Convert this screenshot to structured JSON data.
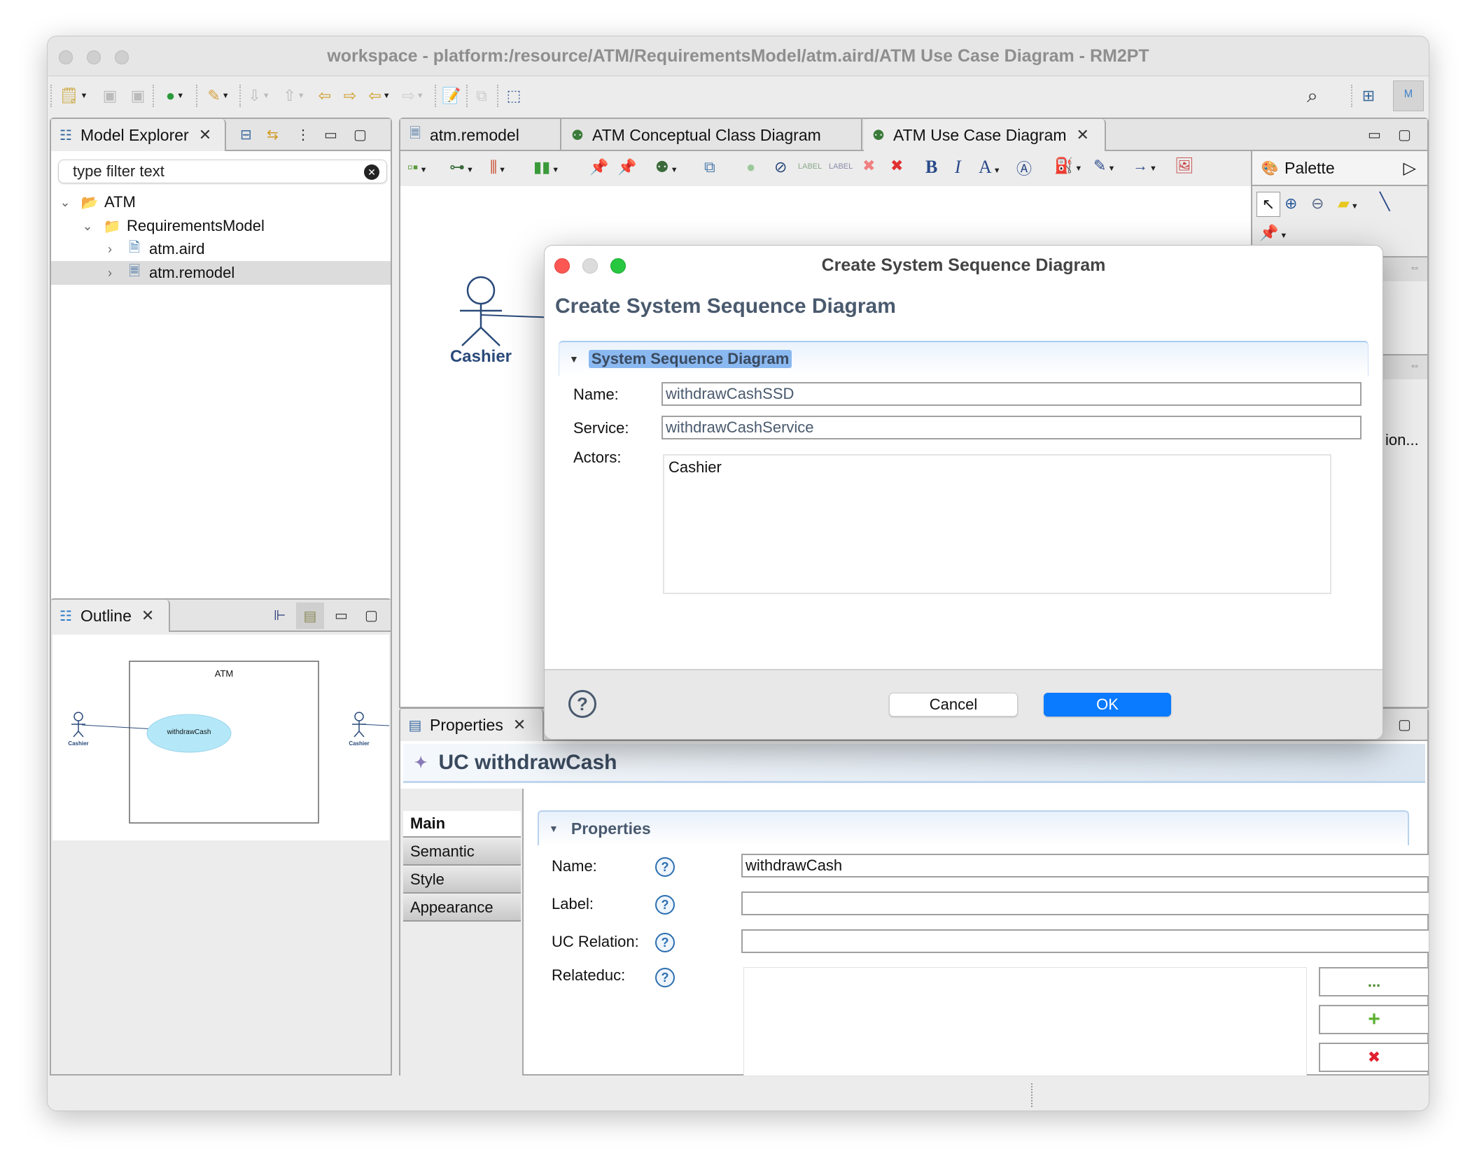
{
  "window": {
    "title": "workspace - platform:/resource/ATM/RequirementsModel/atm.aird/ATM Use Case Diagram - RM2PT"
  },
  "main_toolbar": {
    "icons": [
      "new-wizard-icon",
      "save-icon",
      "save-all-icon",
      "run-icon",
      "pen-tool-icon",
      "next-annotation-icon",
      "prev-annotation-icon",
      "last-edit-back-icon",
      "last-edit-forward-icon",
      "back-icon",
      "forward-icon",
      "new-note-icon",
      "diagram-copy-icon",
      "select-region-icon"
    ],
    "right_icons": [
      "search-icon",
      "open-perspective-icon",
      "modeling-perspective-icon"
    ]
  },
  "model_explorer": {
    "tab_label": "Model Explorer",
    "filter_placeholder": "type filter text",
    "tree": [
      {
        "label": "ATM",
        "level": 0,
        "expanded": true,
        "icon": "project-icon",
        "warning": true
      },
      {
        "label": "RequirementsModel",
        "level": 1,
        "expanded": true,
        "icon": "folder-icon",
        "warning": true
      },
      {
        "label": "atm.aird",
        "level": 2,
        "expanded": false,
        "icon": "aird-file-icon",
        "warning": false
      },
      {
        "label": "atm.remodel",
        "level": 2,
        "expanded": false,
        "icon": "remodel-file-icon",
        "warning": true,
        "selected": true
      }
    ]
  },
  "outline": {
    "tab_label": "Outline",
    "diagram": {
      "system_label": "ATM",
      "use_case": "withdrawCash",
      "actor_left": "Cashier",
      "actor_right": "Cashier"
    }
  },
  "editor": {
    "tabs": [
      {
        "label": "atm.remodel",
        "active": false
      },
      {
        "label": "ATM Conceptual Class Diagram",
        "active": false
      },
      {
        "label": "ATM Use Case Diagram",
        "active": true
      }
    ],
    "toolbar": {
      "bold": "B",
      "italic": "I",
      "font_color": "A",
      "label_1": "LABEL",
      "label_2": "LABEL"
    },
    "canvas": {
      "actor": "Cashier",
      "truncated_text": "ion..."
    },
    "palette": {
      "title": "Palette"
    }
  },
  "dialog": {
    "window_title": "Create System Sequence Diagram",
    "heading": "Create System Sequence Diagram",
    "section_title": "System Sequence Diagram",
    "fields": {
      "name_label": "Name:",
      "name_value": "withdrawCashSSD",
      "service_label": "Service:",
      "service_value": "withdrawCashService",
      "actors_label": "Actors:",
      "actors": [
        "Cashier"
      ]
    },
    "cancel_label": "Cancel",
    "ok_label": "OK",
    "accent": "#0a7aff"
  },
  "properties": {
    "tab_label": "Properties",
    "header": "UC withdrawCash",
    "side_tabs": [
      {
        "label": "Main",
        "active": true
      },
      {
        "label": "Semantic",
        "active": false
      },
      {
        "label": "Style",
        "active": false
      },
      {
        "label": "Appearance",
        "active": false
      }
    ],
    "section_title": "Properties",
    "fields": {
      "name_label": "Name:",
      "name_value": "withdrawCash",
      "label_label": "Label:",
      "label_value": "",
      "ucrel_label": "UC Relation:",
      "ucrel_value": "",
      "related_label": "Relateduc:"
    },
    "buttons": {
      "browse": "...",
      "add": "+",
      "remove": "✖"
    }
  }
}
